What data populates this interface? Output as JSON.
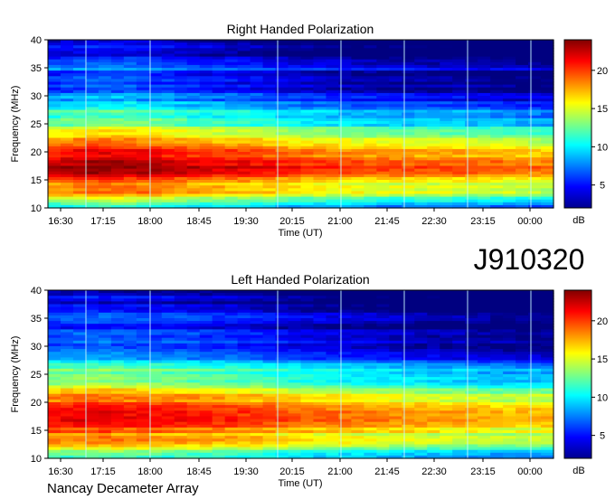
{
  "figure": {
    "observation_id": "J910320",
    "instrument": "Nancay Decameter Array"
  },
  "chart_data": [
    {
      "type": "heatmap",
      "title": "Right Handed Polarization",
      "xlabel": "Time (UT)",
      "ylabel": "Frequency (MHz)",
      "x_tick_labels": [
        "16:30",
        "17:15",
        "18:00",
        "18:45",
        "19:30",
        "20:15",
        "21:00",
        "21:45",
        "22:30",
        "23:15",
        "00:00"
      ],
      "y_ticks": [
        10,
        15,
        20,
        25,
        30,
        35,
        40
      ],
      "ylim": [
        10,
        40
      ],
      "colorbar": {
        "label": "dB",
        "ticks": [
          5,
          10,
          15,
          20
        ],
        "range": [
          2,
          24
        ]
      },
      "colormap": "jet",
      "profile_by_frequency": [
        {
          "mhz": 10,
          "db": 10
        },
        {
          "mhz": 11,
          "db": 13
        },
        {
          "mhz": 12,
          "db": 17
        },
        {
          "mhz": 13,
          "db": 19
        },
        {
          "mhz": 14,
          "db": 18
        },
        {
          "mhz": 15,
          "db": 21
        },
        {
          "mhz": 16,
          "db": 22
        },
        {
          "mhz": 17,
          "db": 23
        },
        {
          "mhz": 18,
          "db": 23
        },
        {
          "mhz": 19,
          "db": 22
        },
        {
          "mhz": 20,
          "db": 22
        },
        {
          "mhz": 21,
          "db": 20
        },
        {
          "mhz": 22,
          "db": 19
        },
        {
          "mhz": 23,
          "db": 17
        },
        {
          "mhz": 24,
          "db": 15
        },
        {
          "mhz": 25,
          "db": 13
        },
        {
          "mhz": 26,
          "db": 12
        },
        {
          "mhz": 27,
          "db": 13
        },
        {
          "mhz": 28,
          "db": 10
        },
        {
          "mhz": 29,
          "db": 9
        },
        {
          "mhz": 30,
          "db": 8
        },
        {
          "mhz": 31,
          "db": 7
        },
        {
          "mhz": 32,
          "db": 6
        },
        {
          "mhz": 33,
          "db": 8
        },
        {
          "mhz": 34,
          "db": 6
        },
        {
          "mhz": 35,
          "db": 9
        },
        {
          "mhz": 36,
          "db": 6
        },
        {
          "mhz": 37,
          "db": 5
        },
        {
          "mhz": 38,
          "db": 4
        },
        {
          "mhz": 39,
          "db": 5
        },
        {
          "mhz": 40,
          "db": 4
        }
      ],
      "profile_by_time": [
        {
          "t": "16:30",
          "offset_db": 1
        },
        {
          "t": "17:15",
          "offset_db": 2
        },
        {
          "t": "18:00",
          "offset_db": 1.5
        },
        {
          "t": "18:45",
          "offset_db": 0.5
        },
        {
          "t": "19:30",
          "offset_db": 0
        },
        {
          "t": "20:15",
          "offset_db": -1
        },
        {
          "t": "21:00",
          "offset_db": -1.5
        },
        {
          "t": "21:45",
          "offset_db": -2
        },
        {
          "t": "22:30",
          "offset_db": -2
        },
        {
          "t": "23:15",
          "offset_db": -2.5
        },
        {
          "t": "00:00",
          "offset_db": -3
        }
      ],
      "vertical_line_times": [
        "17:00",
        "18:00",
        "19:30",
        "20:15",
        "21:00",
        "21:45",
        "22:30",
        "23:15",
        "00:00"
      ]
    },
    {
      "type": "heatmap",
      "title": "Left Handed Polarization",
      "xlabel": "Time (UT)",
      "ylabel": "Frequency (MHz)",
      "x_tick_labels": [
        "16:30",
        "17:15",
        "18:00",
        "18:45",
        "19:30",
        "20:15",
        "21:00",
        "21:45",
        "22:30",
        "23:15",
        "00:00"
      ],
      "y_ticks": [
        10,
        15,
        20,
        25,
        30,
        35,
        40
      ],
      "ylim": [
        10,
        40
      ],
      "colorbar": {
        "label": "dB",
        "ticks": [
          5,
          10,
          15,
          20
        ],
        "range": [
          2,
          24
        ]
      },
      "colormap": "jet",
      "profile_by_frequency": [
        {
          "mhz": 10,
          "db": 11
        },
        {
          "mhz": 11,
          "db": 14
        },
        {
          "mhz": 12,
          "db": 16
        },
        {
          "mhz": 13,
          "db": 20
        },
        {
          "mhz": 14,
          "db": 18
        },
        {
          "mhz": 15,
          "db": 20
        },
        {
          "mhz": 16,
          "db": 22
        },
        {
          "mhz": 17,
          "db": 22
        },
        {
          "mhz": 18,
          "db": 22
        },
        {
          "mhz": 19,
          "db": 21
        },
        {
          "mhz": 20,
          "db": 20
        },
        {
          "mhz": 21,
          "db": 19
        },
        {
          "mhz": 22,
          "db": 17
        },
        {
          "mhz": 23,
          "db": 15
        },
        {
          "mhz": 24,
          "db": 14
        },
        {
          "mhz": 25,
          "db": 12
        },
        {
          "mhz": 26,
          "db": 13
        },
        {
          "mhz": 27,
          "db": 11
        },
        {
          "mhz": 28,
          "db": 9
        },
        {
          "mhz": 29,
          "db": 8
        },
        {
          "mhz": 30,
          "db": 7
        },
        {
          "mhz": 31,
          "db": 8
        },
        {
          "mhz": 32,
          "db": 7
        },
        {
          "mhz": 33,
          "db": 6
        },
        {
          "mhz": 34,
          "db": 5
        },
        {
          "mhz": 35,
          "db": 9
        },
        {
          "mhz": 36,
          "db": 6
        },
        {
          "mhz": 37,
          "db": 5
        },
        {
          "mhz": 38,
          "db": 4
        },
        {
          "mhz": 39,
          "db": 5
        },
        {
          "mhz": 40,
          "db": 4
        }
      ],
      "profile_by_time": [
        {
          "t": "16:30",
          "offset_db": 1
        },
        {
          "t": "17:15",
          "offset_db": 1.5
        },
        {
          "t": "18:00",
          "offset_db": 1
        },
        {
          "t": "18:45",
          "offset_db": 0.5
        },
        {
          "t": "19:30",
          "offset_db": 0
        },
        {
          "t": "20:15",
          "offset_db": -1
        },
        {
          "t": "21:00",
          "offset_db": -1.5
        },
        {
          "t": "21:45",
          "offset_db": -2
        },
        {
          "t": "22:30",
          "offset_db": -2.5
        },
        {
          "t": "23:15",
          "offset_db": -3
        },
        {
          "t": "00:00",
          "offset_db": -3
        }
      ],
      "vertical_line_times": [
        "17:00",
        "18:00",
        "19:30",
        "20:15",
        "21:00",
        "21:45",
        "22:30",
        "23:15",
        "00:00"
      ]
    }
  ]
}
